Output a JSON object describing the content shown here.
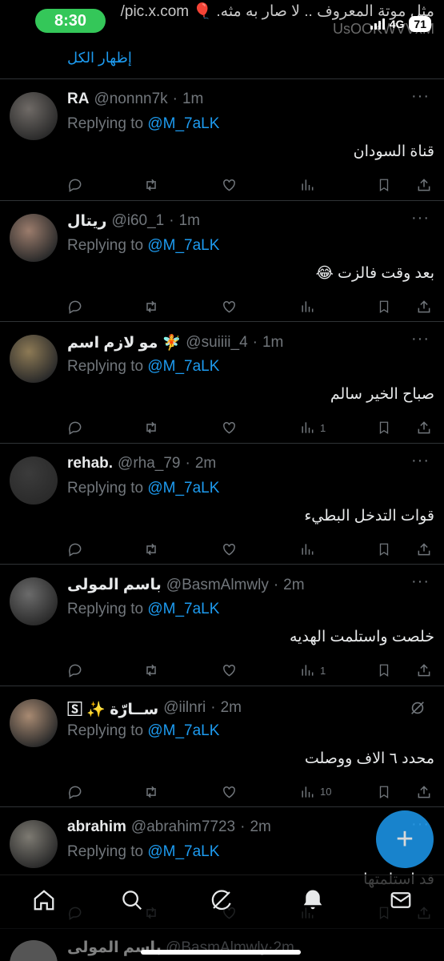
{
  "status_bar": {
    "time": "8:30",
    "top_text": "مثل موتة المعروف .. لا صار به مثه. 🎈 pic.x.com/",
    "top_text_2": "UsOOKWVVxM",
    "network": "4G",
    "battery": "71"
  },
  "show_all": "إظهار الكل",
  "replying_to": "Replying to",
  "mention": "@M_7aLK",
  "dot": "·",
  "tweets": [
    {
      "name": "RA",
      "handle": "@nonnn7k",
      "age": "1m",
      "text": "قناة السودان",
      "views": "",
      "avatar_color": "#6f6a66"
    },
    {
      "name": "ريتال",
      "handle": "@i60_1",
      "age": "1m",
      "text": "بعد وقت فالزت 😂",
      "views": "",
      "avatar_color": "#9b7c6c"
    },
    {
      "name": "مو لازم اسم 🧚",
      "handle": "@suiiii_4",
      "age": "1m",
      "text": "صباح الخير سالم",
      "views": "1",
      "avatar_color": "#8d7a55"
    },
    {
      "name": "rehab.",
      "handle": "@rha_79",
      "age": "2m",
      "text": "قوات التدخل البطيء",
      "views": "",
      "avatar_color": "#3b3b3b"
    },
    {
      "name": "باسم المولى",
      "handle": "@BasmAlmwly",
      "age": "2m",
      "text": "خلصت واستلمت الهديه",
      "views": "1",
      "avatar_color": "#6b6b6b"
    },
    {
      "name": "🅂 ✨ ســارّة",
      "handle": "@iilnri",
      "age": "2m",
      "text": "محدد ٦ الاف ووصلت",
      "views": "10",
      "avatar_color": "#a88a72"
    },
    {
      "name": "abrahim",
      "handle": "@abrahim7723",
      "age": "2m",
      "text": "قد استلمتها",
      "views": "",
      "avatar_color": "#7d7a72"
    }
  ],
  "peek_row": {
    "name": "باسم المولى",
    "handle": "@BasmAlmwly",
    "age": "2m"
  },
  "fab_label": "+",
  "nav": [
    "home-icon",
    "search-icon",
    "grok-icon",
    "notifications-icon",
    "messages-icon"
  ],
  "colors": {
    "accent": "#1d9bf0",
    "muted": "#71767b",
    "background": "#000000",
    "pill": "#34c759"
  }
}
